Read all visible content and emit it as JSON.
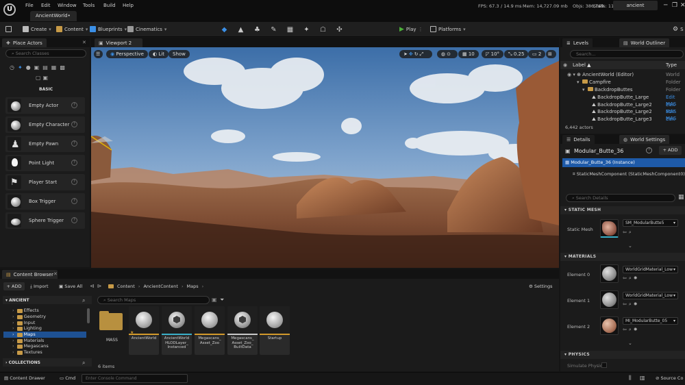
{
  "app": {
    "logo_letter": "U",
    "document_tab": "AncientWorld•",
    "project_name": "ancient",
    "menu": [
      "File",
      "Edit",
      "Window",
      "Tools",
      "Build",
      "Help"
    ],
    "stats": {
      "fps": "FPS: 67.3",
      "ms": "/ 14.9 ms",
      "mem": "Mem: 14,727.09 mb",
      "objs": "Objs: 386,769",
      "stalls": "Stalls: 11"
    },
    "window_controls": [
      "─",
      "❐",
      "✕"
    ]
  },
  "toolbar": {
    "create": "Create",
    "content": "Content",
    "blueprints": "Blueprints",
    "cinematics": "Cinematics",
    "play": "Play",
    "platforms": "Platforms",
    "settings_trunc": "S"
  },
  "place_actors": {
    "tab": "Place Actors",
    "search_placeholder": "Search Classes",
    "category": "BASIC",
    "items": [
      {
        "label": "Empty Actor"
      },
      {
        "label": "Empty Character"
      },
      {
        "label": "Empty Pawn"
      },
      {
        "label": "Point Light"
      },
      {
        "label": "Player Start"
      },
      {
        "label": "Box Trigger"
      },
      {
        "label": "Sphere Trigger"
      }
    ]
  },
  "viewport": {
    "tab": "Viewport 2",
    "perspective": "Perspective",
    "lit": "Lit",
    "show": "Show",
    "grid": "10",
    "angle": "10°",
    "scale": "0.25",
    "camera": "2"
  },
  "outliner": {
    "tab_levels": "Levels",
    "tab_outliner": "World Outliner",
    "search_placeholder": "Search...",
    "col_label": "Label ▲",
    "col_type": "Type",
    "rows": [
      {
        "label": "AncientWorld (Editor)",
        "type": "World"
      },
      {
        "label": "Campfire",
        "type": "Folder"
      },
      {
        "label": "BackdropButtes",
        "type": "Folder"
      },
      {
        "label": "BackdropButte_Large",
        "type": "Edit MAS"
      },
      {
        "label": "BackdropButte_Large2",
        "type": "Edit MAS"
      },
      {
        "label": "BackdropButte_Large2",
        "type": "Edit MAS"
      },
      {
        "label": "BackdropButte_Large3",
        "type": "Edit MAS"
      }
    ],
    "count": "6,442 actors"
  },
  "details": {
    "tab_details": "Details",
    "tab_world": "World Settings",
    "actor_name": "Modular_Butte_36",
    "add_label": "+ ADD",
    "instance": "Modular_Butte_36 (Instance)",
    "component": "StaticMeshComponent (StaticMeshComponent0) (I",
    "search_placeholder": "Search Details",
    "static_mesh_section": "STATIC MESH",
    "static_mesh_label": "Static Mesh",
    "static_mesh_value": "SM_ModularButte5",
    "materials_section": "MATERIALS",
    "elements": [
      {
        "label": "Element 0",
        "value": "WorldGridMaterial_Low"
      },
      {
        "label": "Element 1",
        "value": "WorldGridMaterial_Low"
      },
      {
        "label": "Element 2",
        "value": "MI_ModularButte_05"
      }
    ],
    "physics_section": "PHYSICS",
    "simulate_physics": "Simulate Physic"
  },
  "content_browser": {
    "tab": "Content Browser",
    "add": "+ ADD",
    "import": "Import",
    "save_all": "Save All",
    "breadcrumb": [
      "Content",
      "AncientContent",
      "Maps"
    ],
    "settings": "Settings",
    "root": "ANCIENT",
    "search_maps": "Search Maps",
    "tree": [
      "Effects",
      "Geometry",
      "Input",
      "Lighting",
      "Maps",
      "Materials",
      "Megascans",
      "Textures"
    ],
    "collections": "COLLECTIONS",
    "folder_label": "MASS",
    "assets": [
      {
        "name": "AncientWorld",
        "bar": "#d39a2b"
      },
      {
        "name": "AncientWorld HLODLayer_ Instanced",
        "bar": "#3ab0c9"
      },
      {
        "name": "Megascans_ Asset_Zoo",
        "bar": "#d39a2b"
      },
      {
        "name": "Megascans_ Asset_Zoo_ BuiltData",
        "bar": "#c9c9c9"
      },
      {
        "name": "Startup",
        "bar": "#d39a2b"
      }
    ],
    "items_count": "6 items"
  },
  "bottombar": {
    "content_drawer": "Content Drawer",
    "cmd": "Cmd",
    "console_placeholder": "Enter Console Command",
    "source_control": "Source Co"
  },
  "colors": {
    "accent": "#3b8fe6",
    "play_green": "#4caf3a",
    "folder": "#c79a47",
    "selection": "#1e5aa8"
  }
}
